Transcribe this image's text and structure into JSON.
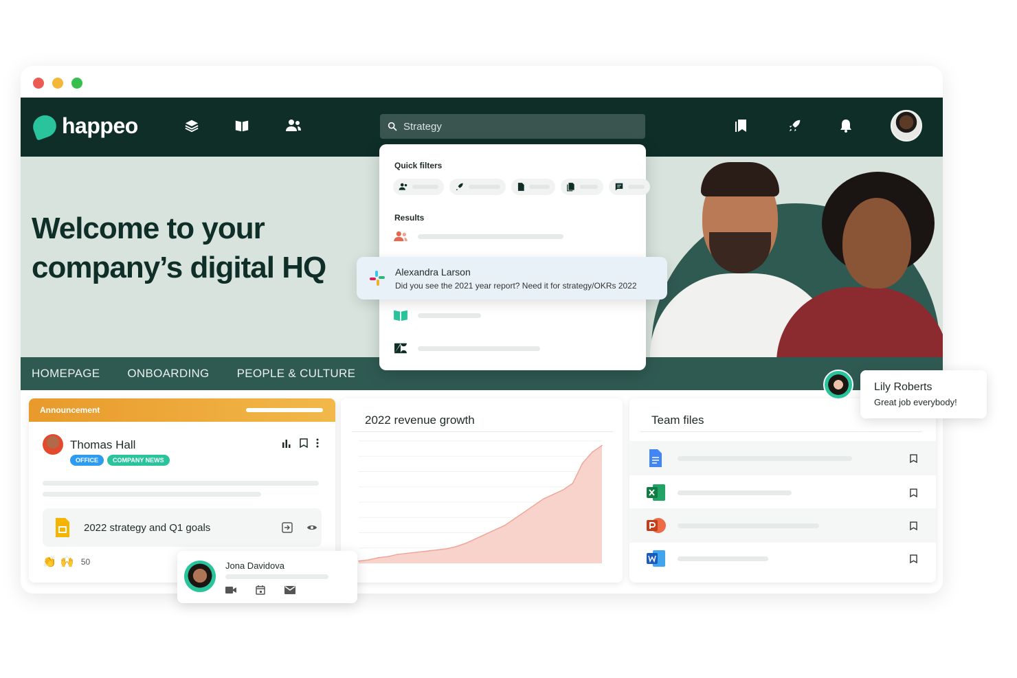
{
  "app": {
    "name": "happeo"
  },
  "search": {
    "value": "Strategy"
  },
  "hero": {
    "title_line1": "Welcome to your",
    "title_line2": "company’s digital HQ"
  },
  "subnav": {
    "items": [
      "HOMEPAGE",
      "ONBOARDING",
      "PEOPLE & CULTURE"
    ]
  },
  "dropdown": {
    "quick_filters_label": "Quick filters",
    "results_label": "Results",
    "highlight": {
      "name": "Alexandra Larson",
      "message": "Did you see the 2021 year report? Need it for strategy/OKRs 2022"
    }
  },
  "announcement": {
    "header": "Announcement",
    "author": "Thomas Hall",
    "tags": [
      "OFFICE",
      "COMPANY NEWS"
    ],
    "doc_title": "2022 strategy and Q1 goals",
    "reaction_count": "50"
  },
  "revenue": {
    "title": "2022 revenue growth"
  },
  "chart_data": {
    "type": "area",
    "title": "2022 revenue growth",
    "xlabel": "",
    "ylabel": "",
    "values": [
      2,
      3,
      5,
      6,
      8,
      9,
      10,
      11,
      12,
      13,
      15,
      18,
      22,
      26,
      30,
      34,
      40,
      46,
      52,
      58,
      62,
      66,
      72,
      90,
      100,
      106
    ],
    "ylim": [
      0,
      110
    ],
    "grid": true,
    "color": "#f8d3cb"
  },
  "team_files": {
    "title": "Team files"
  },
  "contact_popup": {
    "name": "Jona Davidova"
  },
  "chat_popup": {
    "name": "Lily Roberts",
    "message": "Great job everybody!"
  },
  "colors": {
    "dark": "#0f2e28",
    "brand": "#29c49b",
    "hero_bg": "#d7e3dc",
    "subnav": "#2f5a52",
    "accent_orange": "#e89a2b"
  }
}
